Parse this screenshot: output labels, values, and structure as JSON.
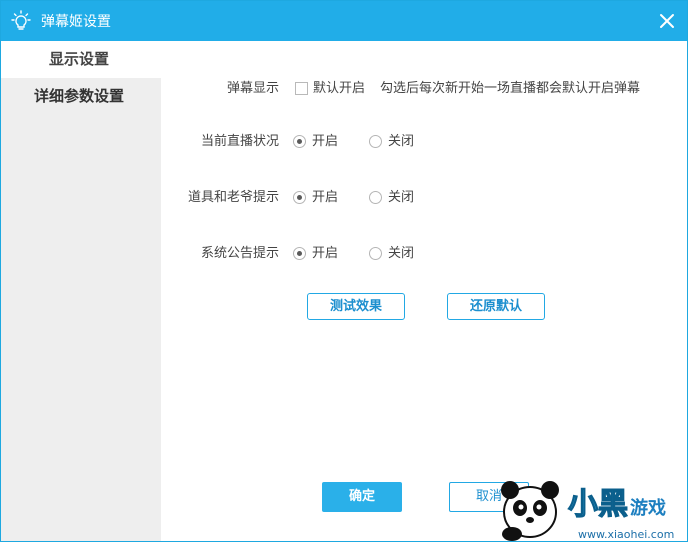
{
  "window": {
    "title": "弹幕姬设置"
  },
  "sidebar": {
    "items": [
      {
        "label": "显示设置"
      },
      {
        "label": "详细参数设置"
      }
    ]
  },
  "settings": {
    "danmaku_display": {
      "label": "弹幕显示",
      "checkbox_label": "默认开启",
      "checked": false,
      "hint": "勾选后每次新开始一场直播都会默认开启弹幕"
    },
    "live_status": {
      "label": "当前直播状况",
      "on_label": "开启",
      "off_label": "关闭",
      "selected": "开启"
    },
    "props_notice": {
      "label": "道具和老爷提示",
      "on_label": "开启",
      "off_label": "关闭",
      "selected": "开启"
    },
    "system_notice": {
      "label": "系统公告提示",
      "on_label": "开启",
      "off_label": "关闭",
      "selected": "开启"
    }
  },
  "actions": {
    "test_label": "测试效果",
    "reset_label": "还原默认",
    "ok_label": "确定",
    "cancel_label": "取消"
  },
  "watermark": {
    "text": "小黑游戏",
    "url": "www.xiaohei.com"
  },
  "colors": {
    "title_bar": "#21ade8",
    "accent": "#22a8e4",
    "sidebar_bg": "#eeeeee"
  }
}
